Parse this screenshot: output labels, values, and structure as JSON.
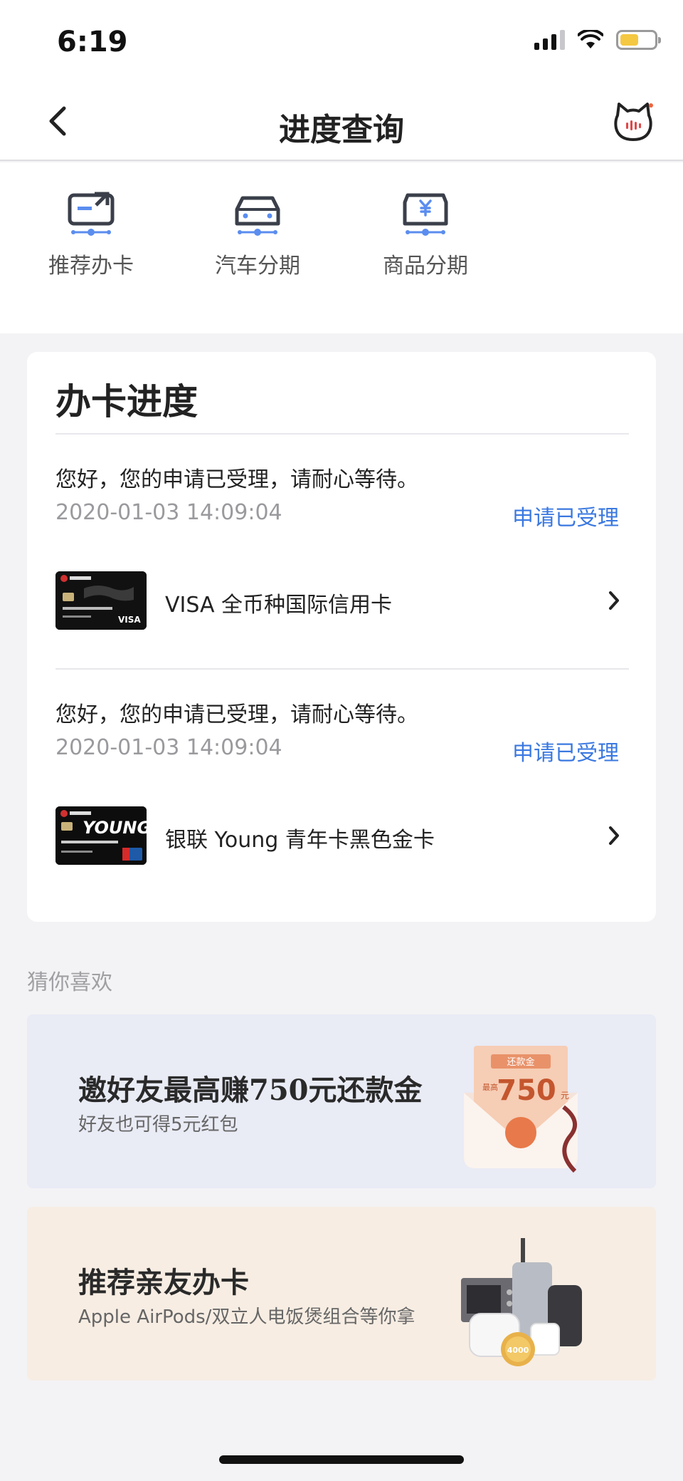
{
  "status_bar": {
    "time": "6:19"
  },
  "nav": {
    "title": "进度查询"
  },
  "quick_links": [
    {
      "label": "推荐办卡",
      "icon": "recommend-card-icon"
    },
    {
      "label": "汽车分期",
      "icon": "car-installment-icon"
    },
    {
      "label": "商品分期",
      "icon": "goods-installment-icon"
    }
  ],
  "progress_card": {
    "title": "办卡进度",
    "entries": [
      {
        "message": "您好，您的申请已受理，请耐心等待。",
        "time": "2020-01-03 14:09:04",
        "status": "申请已受理",
        "card_name": "VISA 全币种国际信用卡"
      },
      {
        "message": "您好，您的申请已受理，请耐心等待。",
        "time": "2020-01-03 14:09:04",
        "status": "申请已受理",
        "card_name": "银联 Young 青年卡黑色金卡"
      }
    ]
  },
  "recommend": {
    "section_label": "猜你喜欢",
    "promos": [
      {
        "title": "邀好友最高赚750元还款金",
        "subtitle": "好友也可得5元红包",
        "badge_top": "还款金",
        "badge_amount": "750",
        "badge_prefix": "最高",
        "badge_unit": "元"
      },
      {
        "title": "推荐亲友办卡",
        "subtitle": "Apple AirPods/双立人电饭煲组合等你拿",
        "coin_text": "4000"
      }
    ]
  },
  "colors": {
    "accent_blue": "#3a78e0",
    "promo_blue_bg": "#e9ebf5",
    "promo_orange_bg": "#f7ede3"
  }
}
